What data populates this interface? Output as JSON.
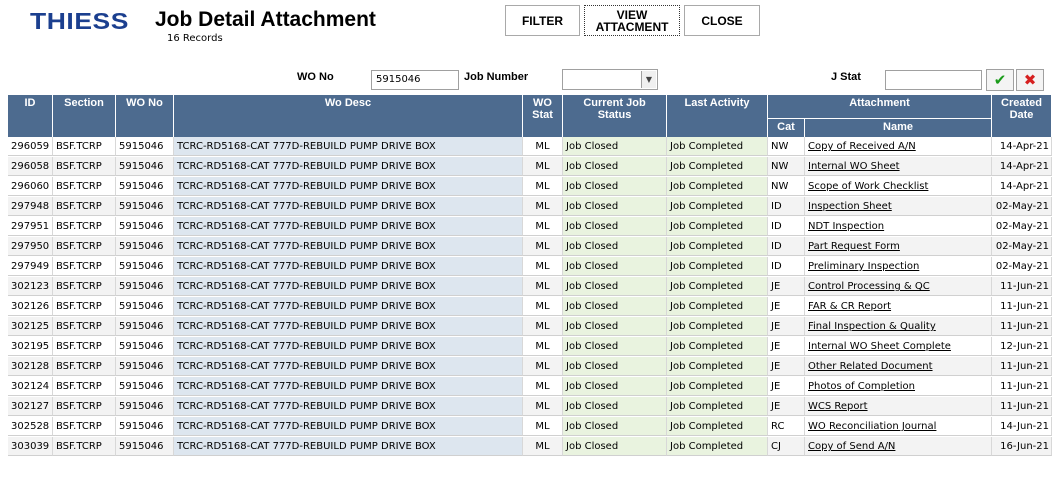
{
  "brand": {
    "logo": "THIESS"
  },
  "header": {
    "title": "Job Detail Attachment",
    "records": "16 Records"
  },
  "toolbar": {
    "filter": "FILTER",
    "view_line1": "VIEW",
    "view_line2": "ATTACMENT",
    "close": "CLOSE"
  },
  "filters": {
    "wo_no_label": "WO No",
    "wo_no_value": "5915046",
    "job_number_label": "Job Number",
    "job_number_value": "",
    "j_stat_label": "J Stat",
    "j_stat_value": "",
    "ok_glyph": "✔",
    "cancel_glyph": "✖"
  },
  "colors": {
    "header_bg": "#4d6b8f",
    "desc_bg": "#dde6ef",
    "status_bg": "#e9f3df",
    "logo": "#1b3f8f"
  },
  "icons": {
    "apply": "check-icon",
    "clear": "x-icon",
    "dropdown": "chevron-down-icon"
  },
  "table": {
    "headers": {
      "id": "ID",
      "section": "Section",
      "wo_no": "WO No",
      "wo_desc": "Wo Desc",
      "wo_stat_1": "WO",
      "wo_stat_2": "Stat",
      "status_1": "Current Job",
      "status_2": "Status",
      "activity": "Last Activity",
      "attachment": "Attachment",
      "cat": "Cat",
      "name": "Name",
      "date_1": "Created",
      "date_2": "Date"
    },
    "rows": [
      {
        "id": "296059",
        "section": "BSF.TCRP",
        "wo": "5915046",
        "desc": "TCRC-RD5168-CAT 777D-REBUILD PUMP DRIVE BOX",
        "stat": "ML",
        "status": "Job Closed",
        "activity": "Job Completed",
        "cat": "NW",
        "name": "Copy of Received A/N",
        "date": "14-Apr-21"
      },
      {
        "id": "296058",
        "section": "BSF.TCRP",
        "wo": "5915046",
        "desc": "TCRC-RD5168-CAT 777D-REBUILD PUMP DRIVE BOX",
        "stat": "ML",
        "status": "Job Closed",
        "activity": "Job Completed",
        "cat": "NW",
        "name": "Internal WO Sheet",
        "date": "14-Apr-21"
      },
      {
        "id": "296060",
        "section": "BSF.TCRP",
        "wo": "5915046",
        "desc": "TCRC-RD5168-CAT 777D-REBUILD PUMP DRIVE BOX",
        "stat": "ML",
        "status": "Job Closed",
        "activity": "Job Completed",
        "cat": "NW",
        "name": "Scope of Work Checklist",
        "date": "14-Apr-21"
      },
      {
        "id": "297948",
        "section": "BSF.TCRP",
        "wo": "5915046",
        "desc": "TCRC-RD5168-CAT 777D-REBUILD PUMP DRIVE BOX",
        "stat": "ML",
        "status": "Job Closed",
        "activity": "Job Completed",
        "cat": "ID",
        "name": "Inspection Sheet",
        "date": "02-May-21"
      },
      {
        "id": "297951",
        "section": "BSF.TCRP",
        "wo": "5915046",
        "desc": "TCRC-RD5168-CAT 777D-REBUILD PUMP DRIVE BOX",
        "stat": "ML",
        "status": "Job Closed",
        "activity": "Job Completed",
        "cat": "ID",
        "name": "NDT Inspection",
        "date": "02-May-21"
      },
      {
        "id": "297950",
        "section": "BSF.TCRP",
        "wo": "5915046",
        "desc": "TCRC-RD5168-CAT 777D-REBUILD PUMP DRIVE BOX",
        "stat": "ML",
        "status": "Job Closed",
        "activity": "Job Completed",
        "cat": "ID",
        "name": "Part Request Form",
        "date": "02-May-21"
      },
      {
        "id": "297949",
        "section": "BSF.TCRP",
        "wo": "5915046",
        "desc": "TCRC-RD5168-CAT 777D-REBUILD PUMP DRIVE BOX",
        "stat": "ML",
        "status": "Job Closed",
        "activity": "Job Completed",
        "cat": "ID",
        "name": "Preliminary Inspection",
        "date": "02-May-21"
      },
      {
        "id": "302123",
        "section": "BSF.TCRP",
        "wo": "5915046",
        "desc": "TCRC-RD5168-CAT 777D-REBUILD PUMP DRIVE BOX",
        "stat": "ML",
        "status": "Job Closed",
        "activity": "Job Completed",
        "cat": "JE",
        "name": "Control Processing & QC",
        "date": "11-Jun-21"
      },
      {
        "id": "302126",
        "section": "BSF.TCRP",
        "wo": "5915046",
        "desc": "TCRC-RD5168-CAT 777D-REBUILD PUMP DRIVE BOX",
        "stat": "ML",
        "status": "Job Closed",
        "activity": "Job Completed",
        "cat": "JE",
        "name": "FAR & CR Report",
        "date": "11-Jun-21"
      },
      {
        "id": "302125",
        "section": "BSF.TCRP",
        "wo": "5915046",
        "desc": "TCRC-RD5168-CAT 777D-REBUILD PUMP DRIVE BOX",
        "stat": "ML",
        "status": "Job Closed",
        "activity": "Job Completed",
        "cat": "JE",
        "name": "Final Inspection & Quality",
        "date": "11-Jun-21"
      },
      {
        "id": "302195",
        "section": "BSF.TCRP",
        "wo": "5915046",
        "desc": "TCRC-RD5168-CAT 777D-REBUILD PUMP DRIVE BOX",
        "stat": "ML",
        "status": "Job Closed",
        "activity": "Job Completed",
        "cat": "JE",
        "name": "Internal WO Sheet Complete",
        "date": "12-Jun-21"
      },
      {
        "id": "302128",
        "section": "BSF.TCRP",
        "wo": "5915046",
        "desc": "TCRC-RD5168-CAT 777D-REBUILD PUMP DRIVE BOX",
        "stat": "ML",
        "status": "Job Closed",
        "activity": "Job Completed",
        "cat": "JE",
        "name": "Other Related Document",
        "date": "11-Jun-21"
      },
      {
        "id": "302124",
        "section": "BSF.TCRP",
        "wo": "5915046",
        "desc": "TCRC-RD5168-CAT 777D-REBUILD PUMP DRIVE BOX",
        "stat": "ML",
        "status": "Job Closed",
        "activity": "Job Completed",
        "cat": "JE",
        "name": "Photos of Completion",
        "date": "11-Jun-21"
      },
      {
        "id": "302127",
        "section": "BSF.TCRP",
        "wo": "5915046",
        "desc": "TCRC-RD5168-CAT 777D-REBUILD PUMP DRIVE BOX",
        "stat": "ML",
        "status": "Job Closed",
        "activity": "Job Completed",
        "cat": "JE",
        "name": "WCS Report",
        "date": "11-Jun-21"
      },
      {
        "id": "302528",
        "section": "BSF.TCRP",
        "wo": "5915046",
        "desc": "TCRC-RD5168-CAT 777D-REBUILD PUMP DRIVE BOX",
        "stat": "ML",
        "status": "Job Closed",
        "activity": "Job Completed",
        "cat": "RC",
        "name": "WO Reconciliation Journal",
        "date": "14-Jun-21"
      },
      {
        "id": "303039",
        "section": "BSF.TCRP",
        "wo": "5915046",
        "desc": "TCRC-RD5168-CAT 777D-REBUILD PUMP DRIVE BOX",
        "stat": "ML",
        "status": "Job Closed",
        "activity": "Job Completed",
        "cat": "CJ",
        "name": "Copy of Send A/N",
        "date": "16-Jun-21"
      }
    ]
  }
}
